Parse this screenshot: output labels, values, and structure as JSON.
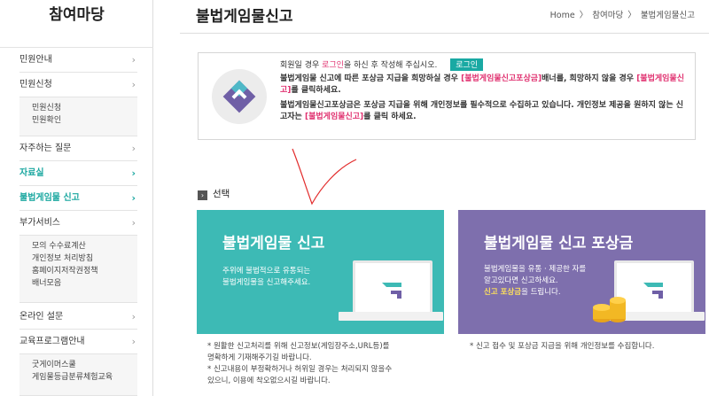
{
  "sidebar": {
    "title": "참여마당",
    "items": [
      {
        "label": "민원안내",
        "chevron": "›"
      },
      {
        "label": "민원신청",
        "chevron": "›"
      },
      {
        "label": "자주하는 질문",
        "chevron": "›"
      },
      {
        "label": "자료실",
        "chevron": "›"
      },
      {
        "label": "불법게임물 신고",
        "chevron": "›"
      },
      {
        "label": "부가서비스",
        "chevron": "›"
      },
      {
        "label": "온라인 설문",
        "chevron": "›"
      },
      {
        "label": "교육프로그램안내",
        "chevron": "›"
      }
    ],
    "sub_minwon": [
      "민원신청",
      "민원확인"
    ],
    "sub_buga": [
      "모의 수수료계산",
      "개인정보 처리방침",
      "홈페이지저작권정책",
      "배너모음"
    ],
    "sub_edu": [
      "굿게이머스쿨",
      "게임물등급분류체험교육"
    ]
  },
  "header": {
    "title": "불법게임물신고",
    "breadcrumb": [
      "Home",
      "〉",
      "참여마당",
      "〉",
      "불법게임물신고"
    ]
  },
  "notice": {
    "line1_pre": "회원일 경우 ",
    "line1_link": "로그인",
    "line1_post": "을 하신 후 작성해 주십시오.",
    "login_button": "로그인",
    "line2_pre": "불법게임물 신고에 따른 포상금 지급을 희망하실 경우 ",
    "line2_link1": "[불법게임물신고포상금]",
    "line2_mid": "배너를, 희망하지 않을 경우 ",
    "line2_link2": "[불법게임물신고]",
    "line2_post": "를 클릭하세요.",
    "line3_pre": "불법게임물신고포상금은 포상금 지급을 위해 개인정보를 필수적으로 수집하고 있습니다. 개인정보 제공을 원하지 않는 신고자는 ",
    "line3_link": "[불법게임물신고]",
    "line3_post": "를 클릭 하세요."
  },
  "section": {
    "label": "선택",
    "box_glyph": "›"
  },
  "cards": {
    "report": {
      "title": "불법게임물 신고",
      "desc1": "주위에 불법적으로 유통되는",
      "desc2": "불법게임물을 신고해주세요."
    },
    "reward": {
      "title": "불법게임물 신고 포상금",
      "desc1": "불법게임물을 유통 · 제공한 자를",
      "desc2": "알고있다면 신고하세요.",
      "desc3_hl": "신고 포상금",
      "desc3_post": "을 드립니다."
    }
  },
  "notes": {
    "left": [
      "*  원활한 신고처리를 위해 신고정보(게임장주소,URL등)를",
      "    명확하게 기재해주기길 바랍니다.",
      "*  신고내용이 부정확하거나 허위일 경우는 처리되지 않을수",
      "    있으니, 이용에 착오없으시길 바랍니다."
    ],
    "right": [
      "*  신고 접수 및 포상금 지급을 위해 개인정보를 수집합니다."
    ]
  },
  "colors": {
    "accent_teal": "#3dbab5",
    "accent_purple": "#7e6fad",
    "link_red": "#e0306f",
    "annotation_red": "#e22b2b"
  },
  "icons": {
    "logo": "grac-logo-icon",
    "monitor": "monitor-icon",
    "coins": "coins-icon",
    "section": "section-bullet-icon",
    "chevron": "chevron-right-icon"
  }
}
